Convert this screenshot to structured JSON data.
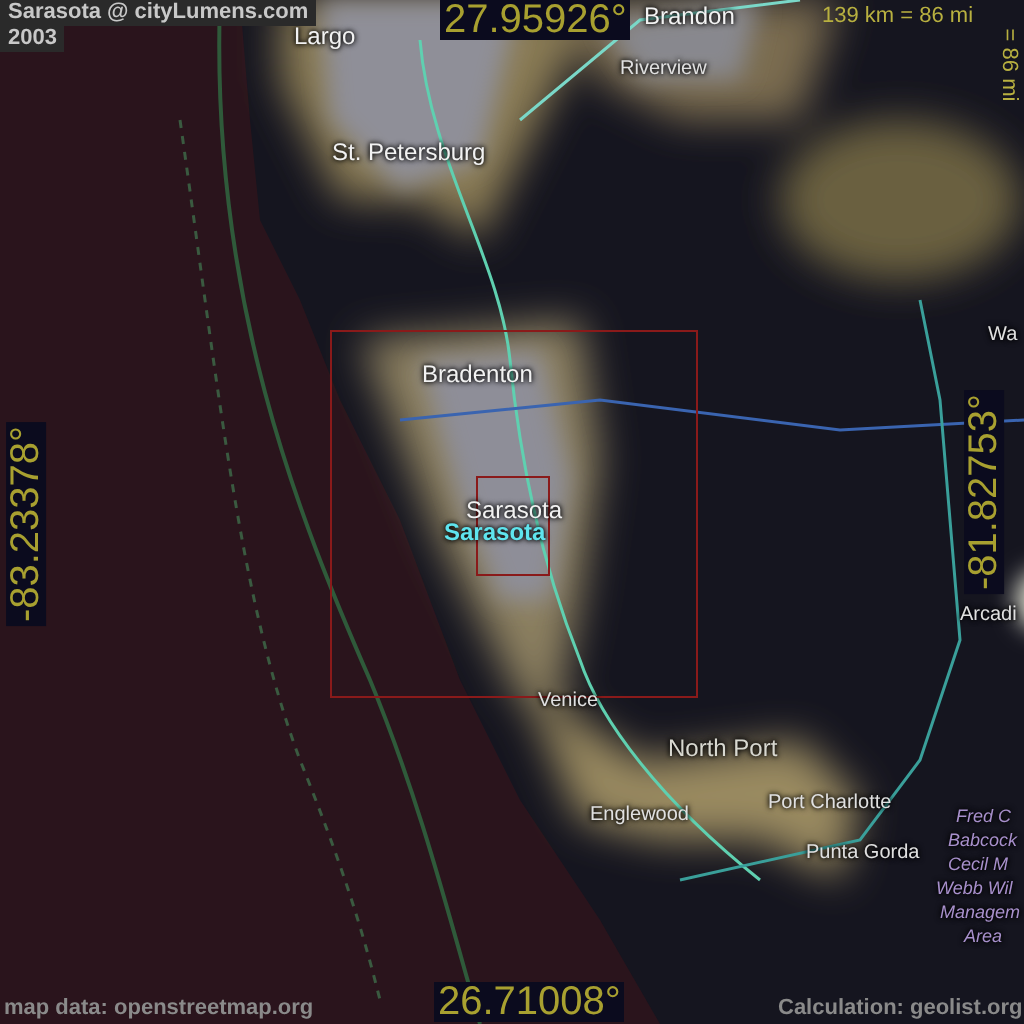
{
  "header": {
    "title": "Sarasota @ cityLumens.com",
    "year": "2003"
  },
  "scale": {
    "horizontal": "139 km = 86 mi",
    "vertical": "= 86 mi"
  },
  "coordinates": {
    "north": "27.95926°",
    "south": "26.71008°",
    "west": "-83.23378°",
    "east": "-81.82753°"
  },
  "places": [
    {
      "name": "Largo",
      "kind": "city"
    },
    {
      "name": "Brandon",
      "kind": "city"
    },
    {
      "name": "Riverview",
      "kind": "small"
    },
    {
      "name": "St. Petersburg",
      "kind": "city"
    },
    {
      "name": "Bradenton",
      "kind": "city"
    },
    {
      "name": "Sarasota",
      "kind": "city"
    },
    {
      "name": "Sarasota",
      "kind": "highlight"
    },
    {
      "name": "Venice",
      "kind": "small"
    },
    {
      "name": "North Port",
      "kind": "town"
    },
    {
      "name": "Port Charlotte",
      "kind": "small"
    },
    {
      "name": "Englewood",
      "kind": "small"
    },
    {
      "name": "Punta Gorda",
      "kind": "small"
    },
    {
      "name": "Wa",
      "kind": "small"
    },
    {
      "name": "Arcadi",
      "kind": "small"
    },
    {
      "name": "Fred C",
      "kind": "area"
    },
    {
      "name": "Babcock",
      "kind": "area"
    },
    {
      "name": "Cecil M",
      "kind": "area"
    },
    {
      "name": "Webb Wil",
      "kind": "area"
    },
    {
      "name": "Managem",
      "kind": "area"
    },
    {
      "name": "Area",
      "kind": "area"
    }
  ],
  "credits": {
    "map_data": "map data: openstreetmap.org",
    "calculation": "Calculation: geolist.org"
  }
}
